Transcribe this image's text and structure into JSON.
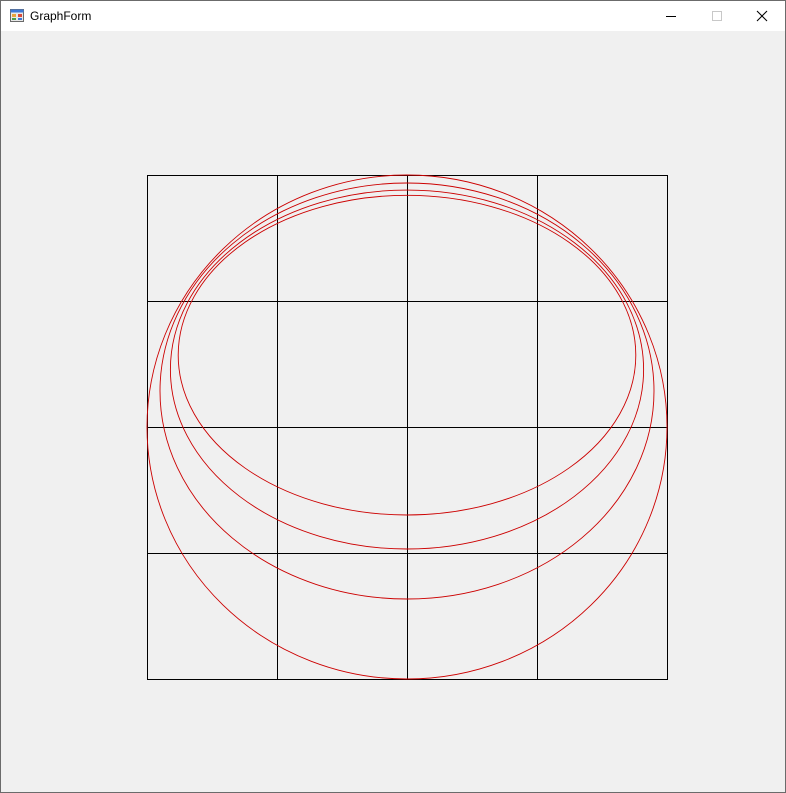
{
  "window": {
    "title": "GraphForm",
    "controls": [
      "minimize-icon",
      "maximize-icon",
      "close-icon"
    ]
  },
  "chart_data": {
    "type": "line",
    "grid": {
      "columns": 4,
      "rows": 4,
      "color": "#000000"
    },
    "curve_color": "#cc0000",
    "series": [
      {
        "x": [
          0,
          8
        ],
        "y": [
          0,
          6
        ]
      },
      {
        "x": [
          0,
          7.6
        ],
        "y": [
          0.85,
          6
        ]
      },
      {
        "x": [
          0,
          7.28
        ],
        "y": [
          1.6,
          6
        ]
      },
      {
        "x": [
          0,
          7.04
        ],
        "y": [
          2.16,
          6
        ]
      }
    ]
  }
}
